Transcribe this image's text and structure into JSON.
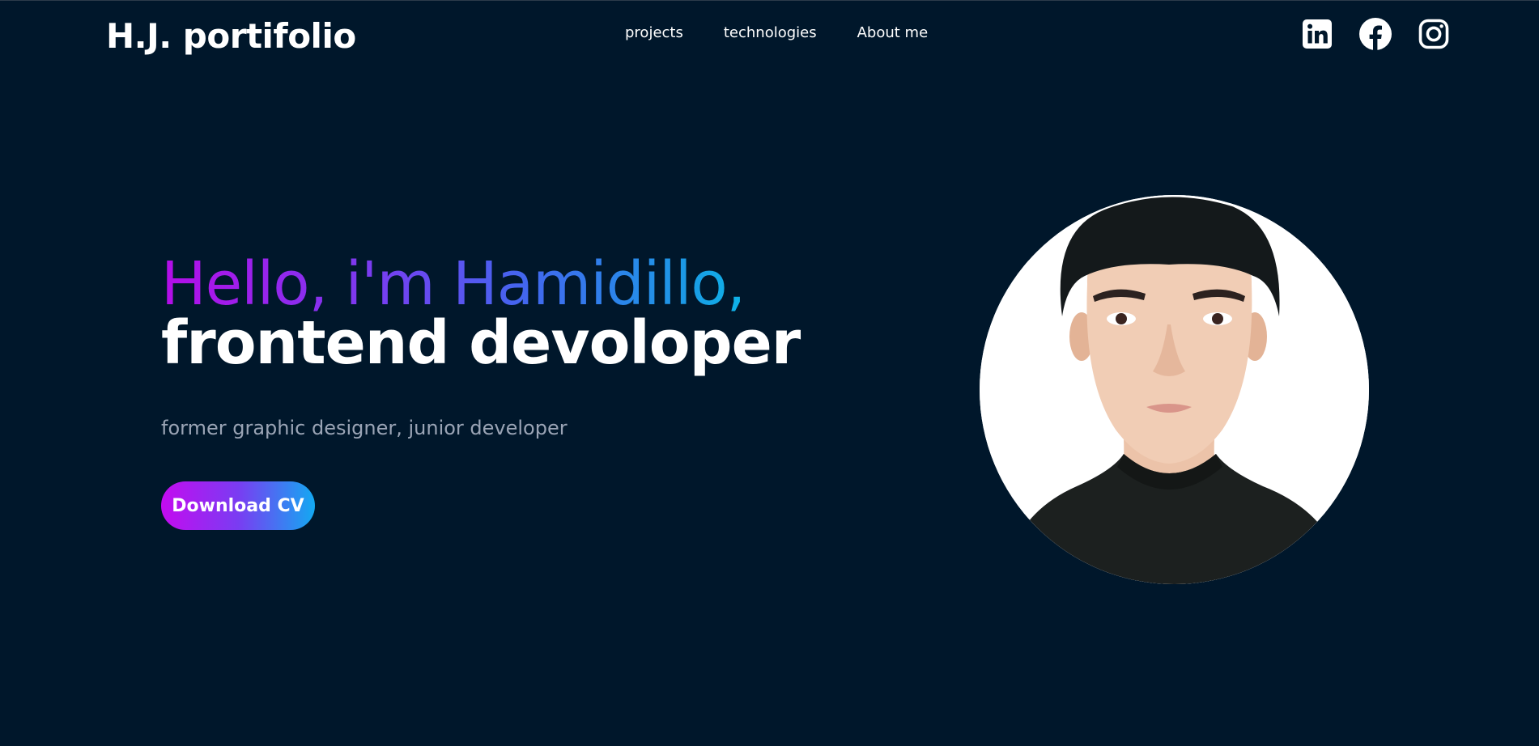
{
  "header": {
    "brand": "H.J. portifolio",
    "nav": [
      {
        "label": "projects"
      },
      {
        "label": "technologies"
      },
      {
        "label": "About me"
      }
    ],
    "socials": [
      {
        "icon": "linkedin-icon"
      },
      {
        "icon": "facebook-icon"
      },
      {
        "icon": "instagram-icon"
      }
    ]
  },
  "hero": {
    "greeting": "Hello, i'm Hamidillo,",
    "role": "frontend devoloper",
    "subtitle": "former graphic designer, junior developer",
    "cta_label": "Download CV",
    "photo_icon": "profile-photo"
  },
  "colors": {
    "background": "#00172b",
    "text": "#ffffff",
    "subtitle": "#9aa4b5",
    "gradient_start": "#c40bf0",
    "gradient_mid": "#7a3cf2",
    "gradient_end": "#13a9f2"
  }
}
